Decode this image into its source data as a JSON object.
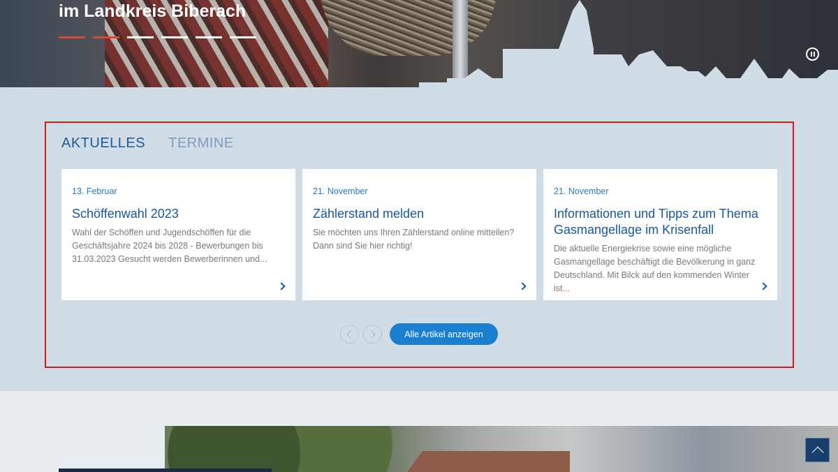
{
  "hero": {
    "title": "im Landkreis Biberach",
    "slides": [
      {
        "active": true
      },
      {
        "active": true
      },
      {
        "active": false
      },
      {
        "active": false
      },
      {
        "active": false
      },
      {
        "active": false
      }
    ]
  },
  "news": {
    "tabs": [
      {
        "label": "AKTUELLES",
        "active": true
      },
      {
        "label": "TERMINE",
        "active": false
      }
    ],
    "cards": [
      {
        "date": "13. Februar",
        "title": "Schöffenwahl 2023",
        "text": "Wahl der Schöffen und Jugendschöffen für die Geschäftsjahre 2024 bis 2028 -      Bewerbungen bis 31.03.2023 Gesucht werden Bewerberinnen und..."
      },
      {
        "date": "21. November",
        "title": "Zählerstand melden",
        "text": "Sie möchten uns Ihren Zählerstand online mitteilen? Dann sind Sie hier richtig!"
      },
      {
        "date": "21. November",
        "title": "Informationen und Tipps zum Thema Gasmangellage im Krisenfall",
        "text": "Die aktuelle Energiekrise sowie eine mögliche Gasmangellage beschäftigt die Bevölkerung in ganz Deutschland. Mit Bilck auf den kommenden Winter ist..."
      }
    ],
    "all_button": "Alle Artikel anzeigen"
  },
  "colors": {
    "accent": "#1b7fd0",
    "title_blue": "#17589a",
    "slide_active": "#d64a38",
    "section_bg": "#d0dde6"
  }
}
